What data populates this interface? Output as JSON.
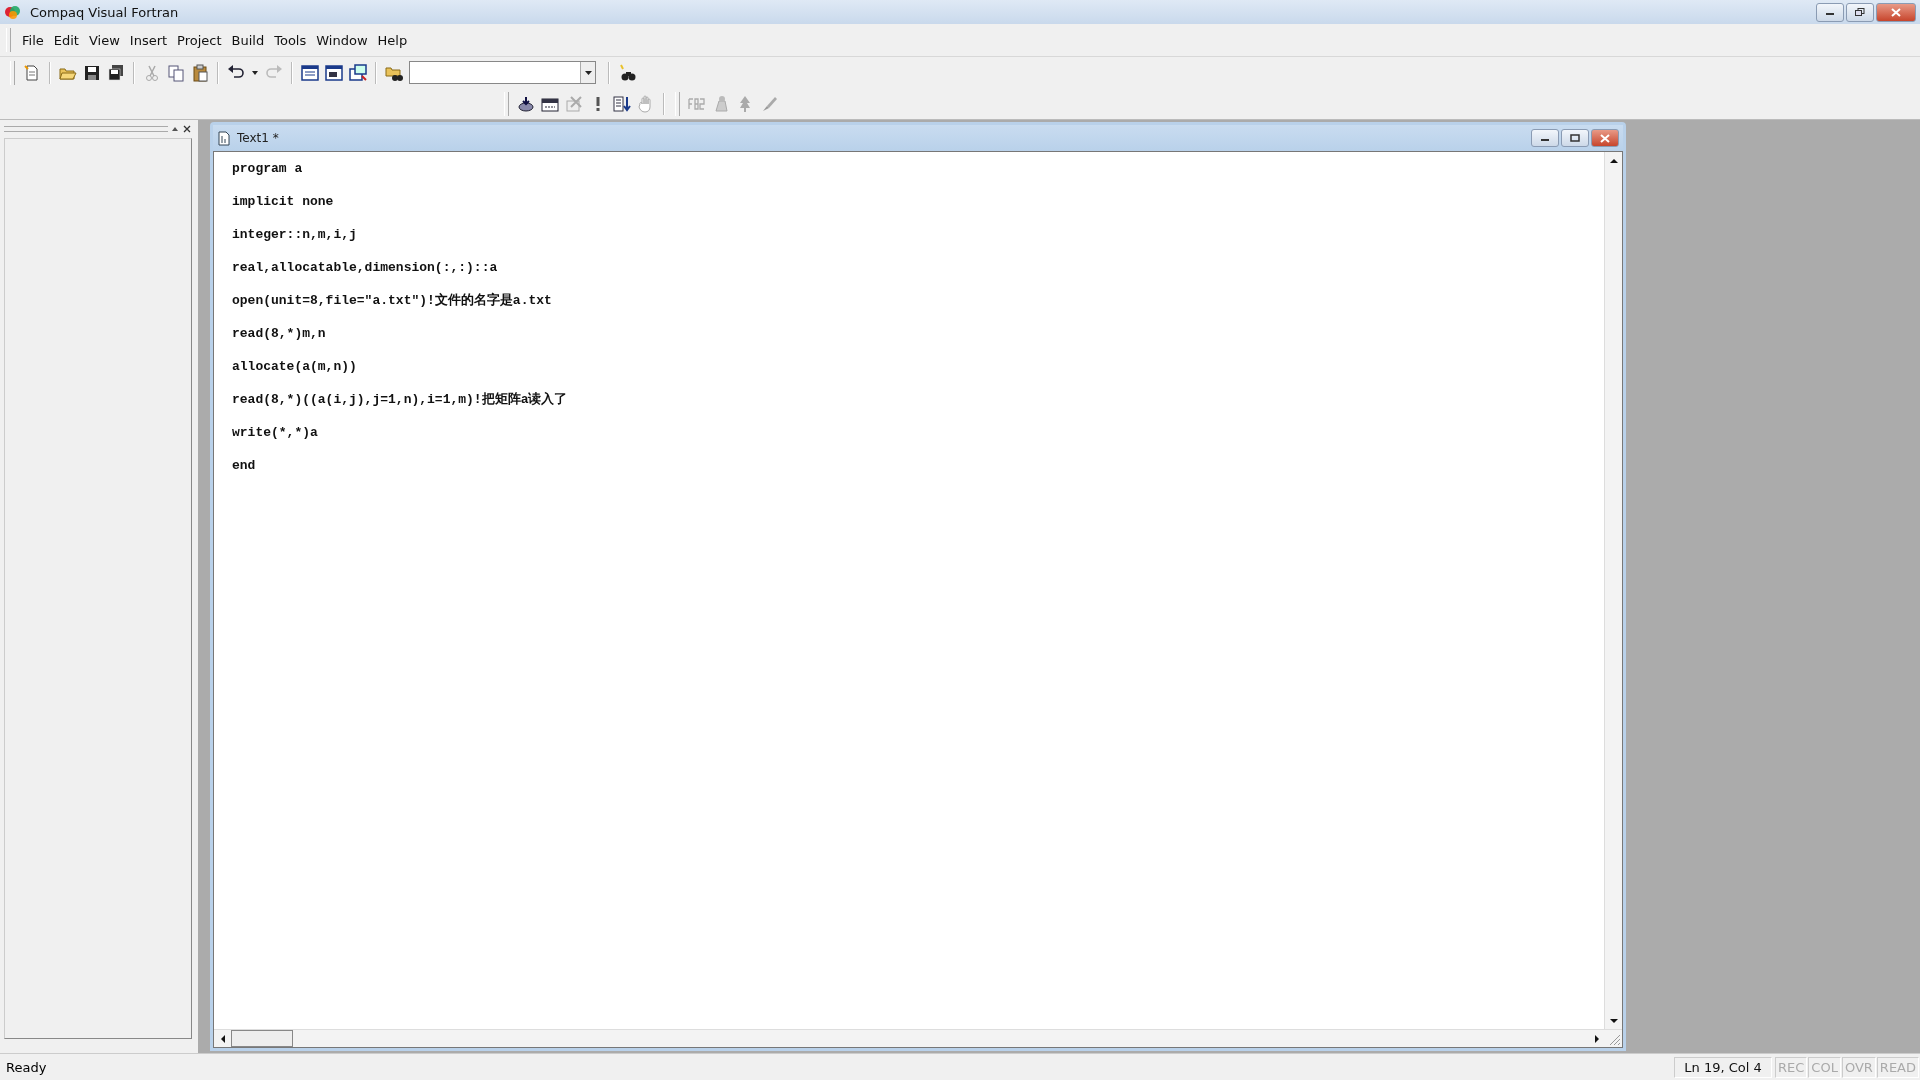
{
  "window": {
    "title": "Compaq Visual Fortran"
  },
  "menu": [
    "File",
    "Edit",
    "View",
    "Insert",
    "Project",
    "Build",
    "Tools",
    "Window",
    "Help"
  ],
  "editor": {
    "title": "Text1 *",
    "lines": [
      "program a",
      "implicit none",
      "integer::n,m,i,j",
      "real,allocatable,dimension(:,:)::a",
      "open(unit=8,file=\"a.txt\")!文件的名字是a.txt",
      "read(8,*)m,n",
      "allocate(a(m,n))",
      "read(8,*)((a(i,j),j=1,n),i=1,m)!把矩阵a读入了",
      "write(*,*)a",
      "end"
    ]
  },
  "status_bar": {
    "message": "Ready",
    "position": "Ln 19, Col 4",
    "indicators": [
      {
        "label": "REC",
        "active": false
      },
      {
        "label": "COL",
        "active": false
      },
      {
        "label": "OVR",
        "active": false
      },
      {
        "label": "READ",
        "active": false
      }
    ]
  }
}
